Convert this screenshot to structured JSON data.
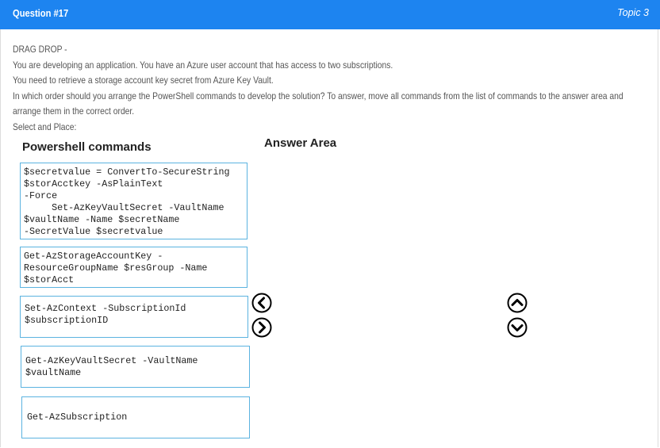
{
  "header": {
    "question_number": "Question #17",
    "topic": "Topic 3"
  },
  "question": {
    "lines": [
      "DRAG DROP -",
      "You are developing an application. You have an Azure user account that has access to two subscriptions.",
      "You need to retrieve a storage account key secret from Azure Key Vault.",
      "In which order should you arrange the PowerShell commands to develop the solution? To answer, move all commands from the list of commands to the answer area and",
      "arrange them in the correct order.",
      "Select and Place:"
    ]
  },
  "commands_panel": {
    "title": "Powershell commands",
    "items": [
      "$secretvalue = ConvertTo-SecureString\n$storAcctkey -AsPlainText\n-Force\n     Set-AzKeyVaultSecret -VaultName\n$vaultName -Name $secretName\n-SecretValue $secretvalue",
      "Get-AzStorageAccountKey -\nResourceGroupName $resGroup -Name\n$storAcct",
      "Set-AzContext -SubscriptionId\n$subscriptionID",
      "Get-AzKeyVaultSecret -VaultName\n$vaultName",
      "Get-AzSubscription"
    ]
  },
  "answer_area": {
    "title": "Answer Area"
  },
  "controls": {
    "move_left_icon": "chevron-left-circle-icon",
    "move_right_icon": "chevron-right-circle-icon",
    "move_up_icon": "chevron-up-circle-icon",
    "move_down_icon": "chevron-down-circle-icon"
  },
  "colors": {
    "header_bg": "#1d84f0",
    "box_border": "#5bb3e0"
  }
}
